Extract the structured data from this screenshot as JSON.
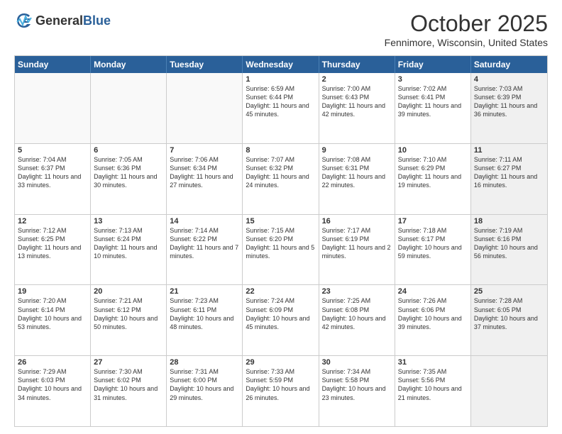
{
  "logo": {
    "general": "General",
    "blue": "Blue"
  },
  "header": {
    "month": "October 2025",
    "location": "Fennimore, Wisconsin, United States"
  },
  "weekdays": [
    "Sunday",
    "Monday",
    "Tuesday",
    "Wednesday",
    "Thursday",
    "Friday",
    "Saturday"
  ],
  "rows": [
    [
      {
        "day": "",
        "empty": true
      },
      {
        "day": "",
        "empty": true
      },
      {
        "day": "",
        "empty": true
      },
      {
        "day": "1",
        "sunrise": "6:59 AM",
        "sunset": "6:44 PM",
        "daylight": "11 hours and 45 minutes."
      },
      {
        "day": "2",
        "sunrise": "7:00 AM",
        "sunset": "6:43 PM",
        "daylight": "11 hours and 42 minutes."
      },
      {
        "day": "3",
        "sunrise": "7:02 AM",
        "sunset": "6:41 PM",
        "daylight": "11 hours and 39 minutes."
      },
      {
        "day": "4",
        "sunrise": "7:03 AM",
        "sunset": "6:39 PM",
        "daylight": "11 hours and 36 minutes.",
        "shaded": true
      }
    ],
    [
      {
        "day": "5",
        "sunrise": "7:04 AM",
        "sunset": "6:37 PM",
        "daylight": "11 hours and 33 minutes."
      },
      {
        "day": "6",
        "sunrise": "7:05 AM",
        "sunset": "6:36 PM",
        "daylight": "11 hours and 30 minutes."
      },
      {
        "day": "7",
        "sunrise": "7:06 AM",
        "sunset": "6:34 PM",
        "daylight": "11 hours and 27 minutes."
      },
      {
        "day": "8",
        "sunrise": "7:07 AM",
        "sunset": "6:32 PM",
        "daylight": "11 hours and 24 minutes."
      },
      {
        "day": "9",
        "sunrise": "7:08 AM",
        "sunset": "6:31 PM",
        "daylight": "11 hours and 22 minutes."
      },
      {
        "day": "10",
        "sunrise": "7:10 AM",
        "sunset": "6:29 PM",
        "daylight": "11 hours and 19 minutes."
      },
      {
        "day": "11",
        "sunrise": "7:11 AM",
        "sunset": "6:27 PM",
        "daylight": "11 hours and 16 minutes.",
        "shaded": true
      }
    ],
    [
      {
        "day": "12",
        "sunrise": "7:12 AM",
        "sunset": "6:25 PM",
        "daylight": "11 hours and 13 minutes."
      },
      {
        "day": "13",
        "sunrise": "7:13 AM",
        "sunset": "6:24 PM",
        "daylight": "11 hours and 10 minutes."
      },
      {
        "day": "14",
        "sunrise": "7:14 AM",
        "sunset": "6:22 PM",
        "daylight": "11 hours and 7 minutes."
      },
      {
        "day": "15",
        "sunrise": "7:15 AM",
        "sunset": "6:20 PM",
        "daylight": "11 hours and 5 minutes."
      },
      {
        "day": "16",
        "sunrise": "7:17 AM",
        "sunset": "6:19 PM",
        "daylight": "11 hours and 2 minutes."
      },
      {
        "day": "17",
        "sunrise": "7:18 AM",
        "sunset": "6:17 PM",
        "daylight": "10 hours and 59 minutes."
      },
      {
        "day": "18",
        "sunrise": "7:19 AM",
        "sunset": "6:16 PM",
        "daylight": "10 hours and 56 minutes.",
        "shaded": true
      }
    ],
    [
      {
        "day": "19",
        "sunrise": "7:20 AM",
        "sunset": "6:14 PM",
        "daylight": "10 hours and 53 minutes."
      },
      {
        "day": "20",
        "sunrise": "7:21 AM",
        "sunset": "6:12 PM",
        "daylight": "10 hours and 50 minutes."
      },
      {
        "day": "21",
        "sunrise": "7:23 AM",
        "sunset": "6:11 PM",
        "daylight": "10 hours and 48 minutes."
      },
      {
        "day": "22",
        "sunrise": "7:24 AM",
        "sunset": "6:09 PM",
        "daylight": "10 hours and 45 minutes."
      },
      {
        "day": "23",
        "sunrise": "7:25 AM",
        "sunset": "6:08 PM",
        "daylight": "10 hours and 42 minutes."
      },
      {
        "day": "24",
        "sunrise": "7:26 AM",
        "sunset": "6:06 PM",
        "daylight": "10 hours and 39 minutes."
      },
      {
        "day": "25",
        "sunrise": "7:28 AM",
        "sunset": "6:05 PM",
        "daylight": "10 hours and 37 minutes.",
        "shaded": true
      }
    ],
    [
      {
        "day": "26",
        "sunrise": "7:29 AM",
        "sunset": "6:03 PM",
        "daylight": "10 hours and 34 minutes."
      },
      {
        "day": "27",
        "sunrise": "7:30 AM",
        "sunset": "6:02 PM",
        "daylight": "10 hours and 31 minutes."
      },
      {
        "day": "28",
        "sunrise": "7:31 AM",
        "sunset": "6:00 PM",
        "daylight": "10 hours and 29 minutes."
      },
      {
        "day": "29",
        "sunrise": "7:33 AM",
        "sunset": "5:59 PM",
        "daylight": "10 hours and 26 minutes."
      },
      {
        "day": "30",
        "sunrise": "7:34 AM",
        "sunset": "5:58 PM",
        "daylight": "10 hours and 23 minutes."
      },
      {
        "day": "31",
        "sunrise": "7:35 AM",
        "sunset": "5:56 PM",
        "daylight": "10 hours and 21 minutes."
      },
      {
        "day": "",
        "empty": true,
        "shaded": true
      }
    ]
  ]
}
